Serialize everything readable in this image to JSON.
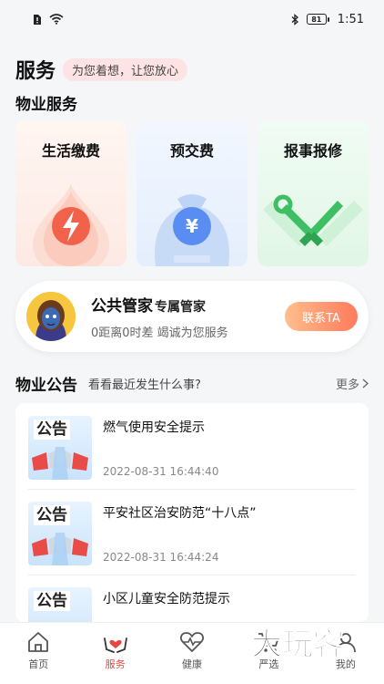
{
  "status": {
    "time": "1:51",
    "battery": "81"
  },
  "header": {
    "title": "服务",
    "slogan": "为您着想，让您放心"
  },
  "property_services": {
    "title": "物业服务",
    "items": [
      {
        "label": "生活缴费",
        "icon": "flame-drop-icon"
      },
      {
        "label": "预交费",
        "icon": "money-bag-icon"
      },
      {
        "label": "报事报修",
        "icon": "tools-icon"
      }
    ]
  },
  "butler": {
    "name": "公共管家",
    "role": "专属管家",
    "desc": "0距离0时差  竭诚为您服务",
    "button": "联系TA"
  },
  "notices": {
    "title": "物业公告",
    "subtitle": "看看最近发生什么事?",
    "more": "更多",
    "thumb_word": "公告",
    "items": [
      {
        "title": "燃气使用安全提示",
        "time": "2022-08-31 16:44:40"
      },
      {
        "title": "平安社区治安防范“十八点”",
        "time": "2022-08-31 16:44:24"
      },
      {
        "title": "小区儿童安全防范提示",
        "time": ""
      }
    ]
  },
  "tabs": [
    {
      "label": "首页",
      "icon": "home-icon"
    },
    {
      "label": "服务",
      "icon": "heart-hands-icon"
    },
    {
      "label": "健康",
      "icon": "health-icon"
    },
    {
      "label": "严选",
      "icon": "cart-icon"
    },
    {
      "label": "我的",
      "icon": "user-icon"
    }
  ],
  "watermark": "大玩客",
  "colors": {
    "accent": "#e8463f",
    "button_start": "#ffbe8c",
    "button_end": "#ff7a5c"
  }
}
